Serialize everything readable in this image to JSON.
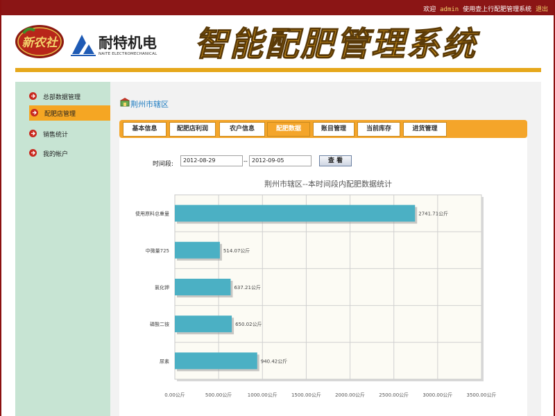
{
  "topbar": {
    "welcome": "欢迎",
    "user": "admin",
    "message": "使用壶上行配肥管理系统",
    "logout": "退出"
  },
  "header": {
    "logo1_text": "新农社",
    "brand_name": "耐特机电",
    "brand_sub": "NAITE ELECTROMECHANICAL",
    "system_title": "智能配肥管理系统"
  },
  "sidebar": {
    "items": [
      {
        "label": "总部数据管理",
        "active": false
      },
      {
        "label": "配肥店管理",
        "active": true
      },
      {
        "label": "销售统计",
        "active": false
      },
      {
        "label": "我的帐户",
        "active": false
      }
    ]
  },
  "main": {
    "breadcrumb": "荆州市辖区",
    "tabs": [
      {
        "label": "基本信息",
        "active": false
      },
      {
        "label": "配肥店利润",
        "active": false
      },
      {
        "label": "农户信息",
        "active": false
      },
      {
        "label": "配肥数据",
        "active": true
      },
      {
        "label": "账目管理",
        "active": false
      },
      {
        "label": "当前库存",
        "active": false
      },
      {
        "label": "进货管理",
        "active": false
      }
    ],
    "filter": {
      "time_label": "时间段:",
      "start_date": "2012-08-29",
      "separator": "--",
      "end_date": "2012-09-05",
      "view_button": "查 看"
    }
  },
  "chart_data": {
    "type": "bar",
    "orientation": "horizontal",
    "title": "荆州市辖区--本时间段内配肥数据统计",
    "categories": [
      "使用原料总重量",
      "中微量725",
      "氯化钾",
      "磷酸二铵",
      "尿素"
    ],
    "values": [
      2741.71,
      514.07,
      637.21,
      650.02,
      940.42
    ],
    "value_labels": [
      "2741.71公斤",
      "514.07公斤",
      "637.21公斤",
      "650.02公斤",
      "940.42公斤"
    ],
    "xlim": [
      0,
      3500
    ],
    "xticks": [
      "0.00公斤",
      "500.00公斤",
      "1000.00公斤",
      "1500.00公斤",
      "2000.00公斤",
      "2500.00公斤",
      "3000.00公斤",
      "3500.00公斤"
    ],
    "bar_color": "#4bb0c4",
    "grid": true
  }
}
